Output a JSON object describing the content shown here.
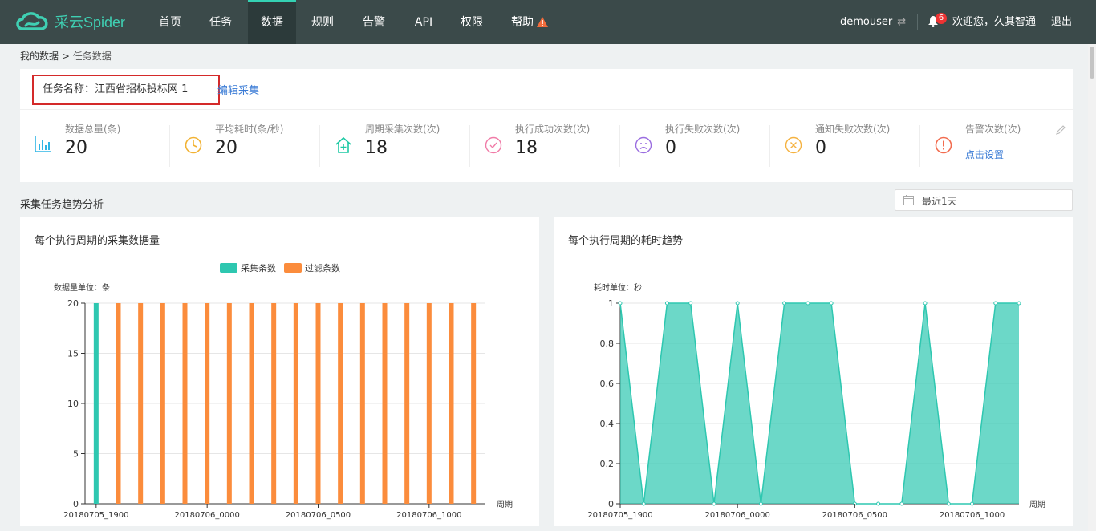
{
  "app": {
    "title": "采云Spider"
  },
  "nav": {
    "items": [
      "首页",
      "任务",
      "数据",
      "规则",
      "告警",
      "API",
      "权限",
      "帮助"
    ],
    "active": "数据"
  },
  "user": {
    "name": "demouser",
    "notifications": "6",
    "welcome": "欢迎您，久其智通",
    "logout": "退出"
  },
  "breadcrumb": {
    "root": "我的数据",
    "sep": ">",
    "current": "任务数据"
  },
  "task": {
    "name": "任务名称：江西省招标投标网 1",
    "edit": "编辑采集"
  },
  "stats": [
    {
      "label": "数据总量(条)",
      "value": "20",
      "icon": "bar-chart-icon",
      "color": "#2fb5e6"
    },
    {
      "label": "平均耗时(条/秒)",
      "value": "20",
      "icon": "clock-icon",
      "color": "#f2b233"
    },
    {
      "label": "周期采集次数(次)",
      "value": "18",
      "icon": "home-plus-icon",
      "color": "#1dc9a4"
    },
    {
      "label": "执行成功次数(次)",
      "value": "18",
      "icon": "check-circle-icon",
      "color": "#f07ba7"
    },
    {
      "label": "执行失败次数(次)",
      "value": "0",
      "icon": "sad-face-icon",
      "color": "#9a6de0"
    },
    {
      "label": "通知失败次数(次)",
      "value": "0",
      "icon": "x-circle-icon",
      "color": "#f5b240"
    },
    {
      "label": "告警次数(次)",
      "link": "点击设置",
      "icon": "alert-circle-icon",
      "color": "#f26c4f"
    }
  ],
  "section": {
    "title": "采集任务趋势分析",
    "date_range": "最近1天"
  },
  "chart_data": [
    {
      "type": "bar",
      "title": "每个执行周期的采集数据量",
      "ylabel": "数据量单位：条",
      "xlabel": "周期",
      "ylim": [
        0,
        20
      ],
      "yticks": [
        0,
        5,
        10,
        15,
        20
      ],
      "xtick_labels": [
        "20180705_1900",
        "20180706_0000",
        "20180706_0500",
        "20180706_1000"
      ],
      "legend": [
        "采集条数",
        "过滤条数"
      ],
      "colors": [
        "#2ec7b0",
        "#fb8c3c"
      ],
      "series": [
        {
          "name": "采集条数",
          "values": [
            20,
            0,
            0,
            0,
            0,
            0,
            0,
            0,
            0,
            0,
            0,
            0,
            0,
            0,
            0,
            0,
            0,
            0
          ]
        },
        {
          "name": "过滤条数",
          "values": [
            0,
            20,
            20,
            20,
            20,
            20,
            20,
            20,
            20,
            20,
            20,
            20,
            20,
            20,
            20,
            20,
            20,
            20
          ]
        }
      ]
    },
    {
      "type": "area",
      "title": "每个执行周期的耗时趋势",
      "ylabel": "耗时单位：秒",
      "xlabel": "周期",
      "ylim": [
        0,
        1
      ],
      "yticks": [
        "0",
        "0.2",
        "0.4",
        "0.6",
        "0.8",
        "1"
      ],
      "xtick_labels": [
        "20180705_1900",
        "20180706_0000",
        "20180706_0500",
        "20180706_1000"
      ],
      "color": "#2ec7b0",
      "values": [
        1,
        0,
        1,
        1,
        0,
        1,
        0,
        1,
        1,
        1,
        0,
        0,
        0,
        1,
        0,
        0,
        1,
        1
      ]
    }
  ]
}
